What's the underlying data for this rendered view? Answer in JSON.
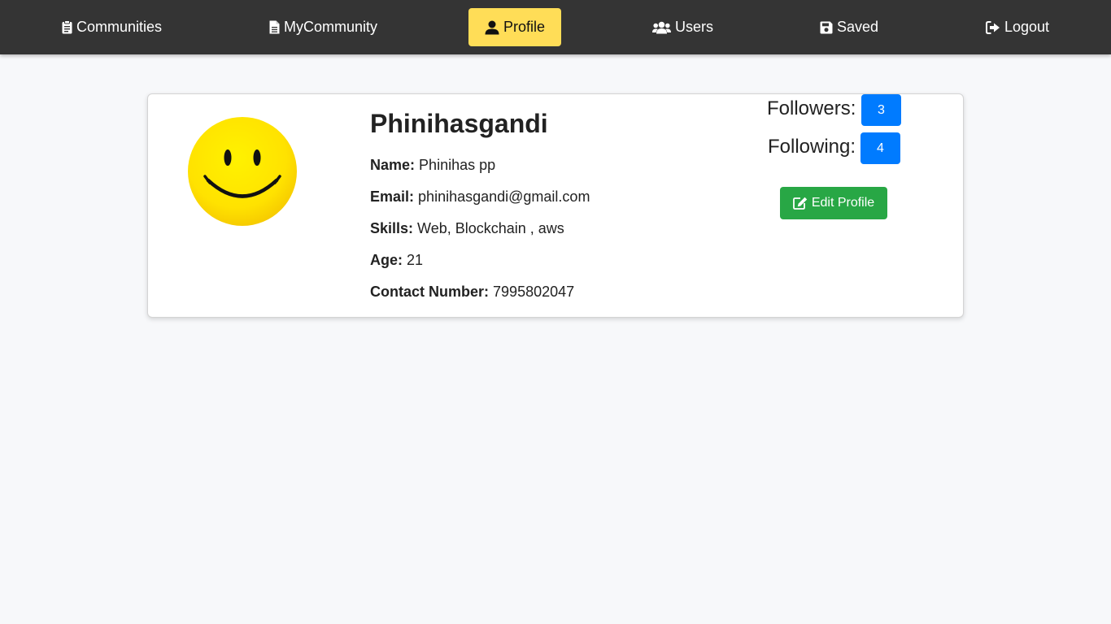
{
  "nav": {
    "items": [
      {
        "label": "Communities",
        "icon": "clipboard-icon"
      },
      {
        "label": "MyCommunity",
        "icon": "document-icon"
      },
      {
        "label": "Profile",
        "icon": "user-icon",
        "active": true
      },
      {
        "label": "Users",
        "icon": "users-icon"
      },
      {
        "label": "Saved",
        "icon": "save-icon"
      },
      {
        "label": "Logout",
        "icon": "logout-icon"
      }
    ]
  },
  "profile": {
    "avatar_icon": "smiley-face-icon",
    "username": "Phinihasgandi",
    "fields": {
      "name": {
        "label": "Name:",
        "value": "Phinihas pp"
      },
      "email": {
        "label": "Email:",
        "value": "phinihasgandi@gmail.com"
      },
      "skills": {
        "label": "Skills:",
        "value": "Web, Blockchain , aws"
      },
      "age": {
        "label": "Age:",
        "value": "21"
      },
      "contact": {
        "label": "Contact Number:",
        "value": "7995802047"
      }
    },
    "followers": {
      "label": "Followers:",
      "count": "3"
    },
    "following": {
      "label": "Following:",
      "count": "4"
    },
    "edit_button": {
      "label": "Edit Profile",
      "icon": "edit-icon"
    }
  },
  "colors": {
    "navbar": "#343434",
    "active_nav": "#ffdd57",
    "badge": "#007bff",
    "edit_button": "#28a745",
    "background": "#f7f8fa"
  }
}
